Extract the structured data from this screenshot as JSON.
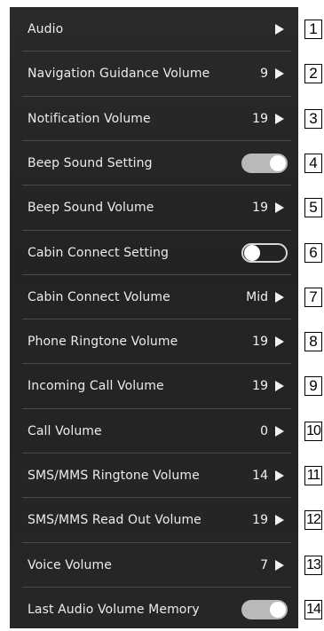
{
  "settings": [
    {
      "label": "Audio",
      "value": "",
      "control": "arrow",
      "callout": "1"
    },
    {
      "label": "Navigation Guidance Volume",
      "value": "9",
      "control": "arrow",
      "callout": "2"
    },
    {
      "label": "Notification Volume",
      "value": "19",
      "control": "arrow",
      "callout": "3"
    },
    {
      "label": "Beep Sound Setting",
      "value": "",
      "control": "toggle-on",
      "callout": "4"
    },
    {
      "label": "Beep Sound Volume",
      "value": "19",
      "control": "arrow",
      "callout": "5"
    },
    {
      "label": "Cabin Connect Setting",
      "value": "",
      "control": "toggle-off",
      "callout": "6"
    },
    {
      "label": "Cabin Connect Volume",
      "value": "Mid",
      "control": "arrow",
      "callout": "7"
    },
    {
      "label": "Phone Ringtone Volume",
      "value": "19",
      "control": "arrow",
      "callout": "8"
    },
    {
      "label": "Incoming Call Volume",
      "value": "19",
      "control": "arrow",
      "callout": "9"
    },
    {
      "label": "Call Volume",
      "value": "0",
      "control": "arrow",
      "callout": "10"
    },
    {
      "label": "SMS/MMS Ringtone Volume",
      "value": "14",
      "control": "arrow",
      "callout": "11"
    },
    {
      "label": "SMS/MMS Read Out Volume",
      "value": "19",
      "control": "arrow",
      "callout": "12"
    },
    {
      "label": "Voice Volume",
      "value": "7",
      "control": "arrow",
      "callout": "13"
    },
    {
      "label": "Last Audio Volume Memory",
      "value": "",
      "control": "toggle-on",
      "callout": "14"
    }
  ],
  "colors": {
    "panel": "#262627",
    "text": "#ececec",
    "toggle_on": "#b9b9bb",
    "divider": "#4a4a4c"
  },
  "icons": {
    "arrow": "play-arrow-icon",
    "toggle": "toggle-switch-icon"
  }
}
